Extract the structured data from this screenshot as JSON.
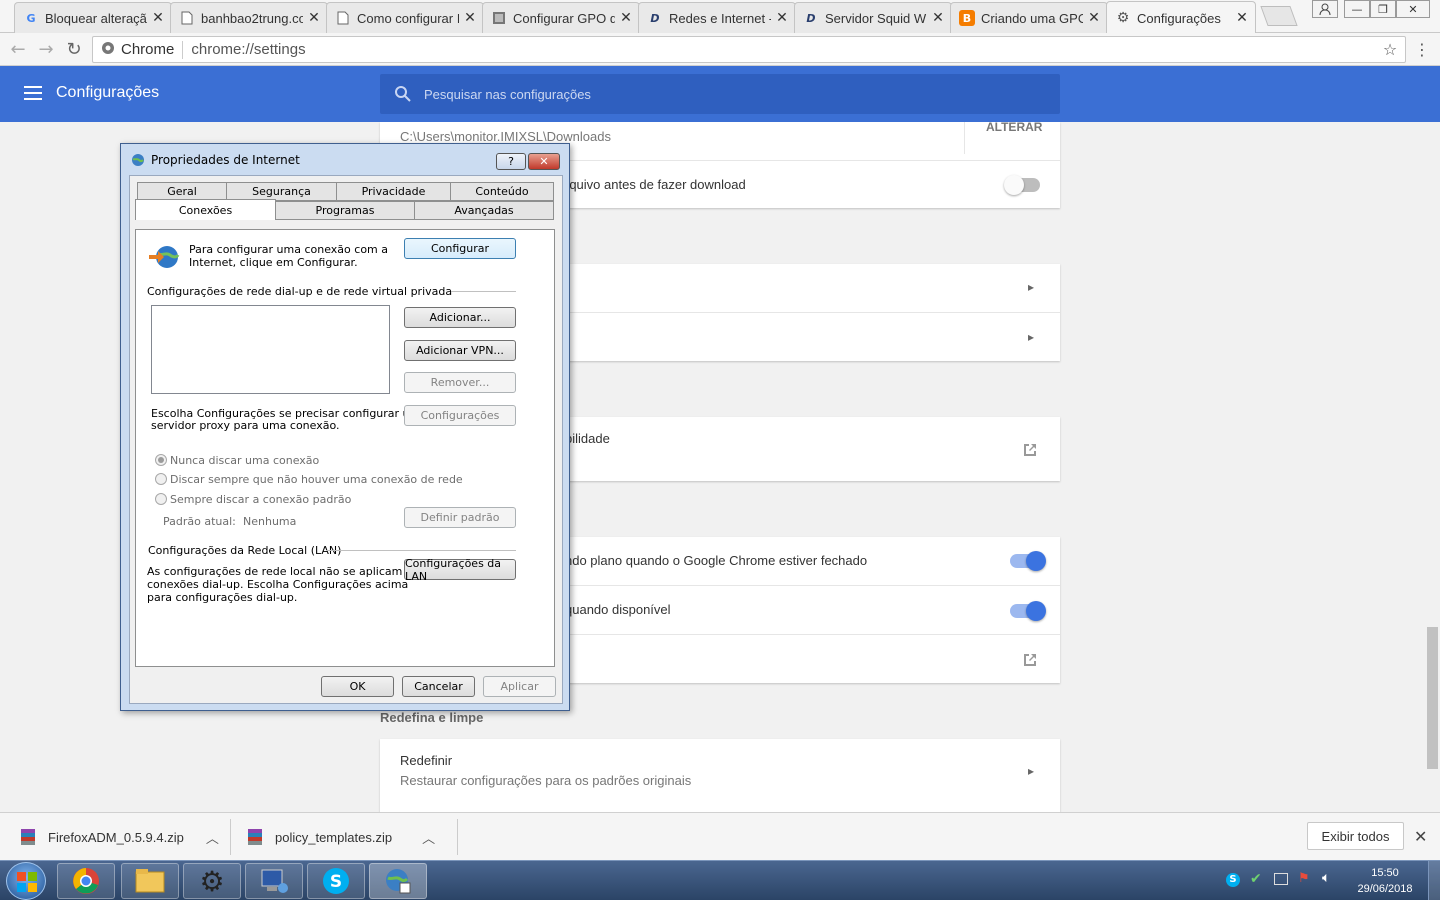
{
  "browser": {
    "tabs": [
      {
        "title": "Bloquear alteraçã",
        "icon": "google-icon"
      },
      {
        "title": "banhbao2trung.co",
        "icon": "page-icon"
      },
      {
        "title": "Como configurar I",
        "icon": "page-icon"
      },
      {
        "title": "Configurar GPO d",
        "icon": "site-icon"
      },
      {
        "title": "Redes e Internet -",
        "icon": "dh-icon"
      },
      {
        "title": "Servidor Squid W",
        "icon": "dh-icon"
      },
      {
        "title": "Criando uma GPO",
        "icon": "blogger-icon"
      },
      {
        "title": "Configurações",
        "icon": "gear-icon"
      }
    ],
    "omnibox": {
      "label": "Chrome",
      "url": "chrome://settings"
    }
  },
  "settings": {
    "title": "Configurações",
    "search_placeholder": "Pesquisar nas configurações",
    "downloads_path": "C:\\Users\\monitor.IMIXSL\\Downloads",
    "change_button": "ALTERAR",
    "ask_download": "rquivo antes de fazer download",
    "accessibility": "bilidade",
    "background_apps": "ndo plano quando o Google Chrome estiver fechado",
    "hardware_accel": "quando disponível",
    "reset_section": "Redefina e limpe",
    "reset_title": "Redefinir",
    "reset_desc": "Restaurar configurações para os padrões originais"
  },
  "dialog": {
    "title": "Propriedades de Internet",
    "tabs_row1": [
      "Geral",
      "Segurança",
      "Privacidade",
      "Conteúdo"
    ],
    "tabs_row2": [
      "Conexões",
      "Programas",
      "Avançadas"
    ],
    "setup_text_1": "Para configurar uma conexão com a",
    "setup_text_2": "Internet, clique em Configurar.",
    "setup_button": "Configurar",
    "dialup_heading": "Configurações de rede dial-up e de rede virtual privada",
    "add_button": "Adicionar...",
    "add_vpn_button": "Adicionar VPN...",
    "remove_button": "Remover...",
    "settings_button": "Configurações",
    "proxy_text_1": "Escolha Configurações se precisar configurar um",
    "proxy_text_2": "servidor proxy para uma conexão.",
    "radio_never": "Nunca discar uma conexão",
    "radio_when_none": "Discar sempre que não houver uma conexão de rede",
    "radio_always": "Sempre discar a conexão padrão",
    "current_default_label": "Padrão atual:",
    "current_default_value": "Nenhuma",
    "set_default_button": "Definir padrão",
    "lan_heading": "Configurações da Rede Local (LAN)",
    "lan_text_1": "As configurações de rede local não se aplicam a",
    "lan_text_2": "conexões dial-up. Escolha Configurações acima",
    "lan_text_3": "para configurações dial-up.",
    "lan_button": "Configurações da LAN",
    "ok_button": "OK",
    "cancel_button": "Cancelar",
    "apply_button": "Aplicar"
  },
  "downloads": {
    "items": [
      "FirefoxADM_0.5.9.4.zip",
      "policy_templates.zip"
    ],
    "show_all": "Exibir todos"
  },
  "taskbar": {
    "time": "15:50",
    "date": "29/06/2018"
  },
  "colors": {
    "header_blue": "#3b6fd4",
    "toggle_on": "#3b73e0"
  }
}
